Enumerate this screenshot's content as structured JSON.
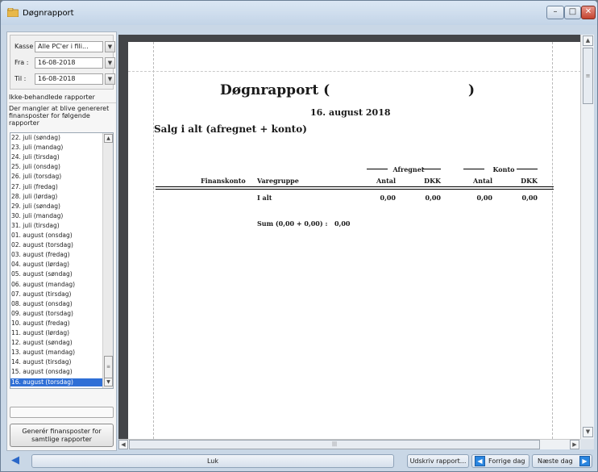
{
  "window": {
    "title": "Døgnrapport"
  },
  "filters": {
    "kasse_label": "Kasse :",
    "kasse_value": "Alle PC'er i fili...",
    "fra_label": "Fra :",
    "fra_value": "16-08-2018",
    "til_label": "Til :",
    "til_value": "16-08-2018"
  },
  "sidebar": {
    "section_title": "Ikke-behandlede rapporter",
    "description": "Der mangler at blive genereret finansposter for følgende rapporter",
    "dates": [
      "22. juli (søndag)",
      "23. juli (mandag)",
      "24. juli (tirsdag)",
      "25. juli (onsdag)",
      "26. juli (torsdag)",
      "27. juli (fredag)",
      "28. juli (lørdag)",
      "29. juli (søndag)",
      "30. juli (mandag)",
      "31. juli (tirsdag)",
      "01. august (onsdag)",
      "02. august (torsdag)",
      "03. august (fredag)",
      "04. august (lørdag)",
      "05. august (søndag)",
      "06. august (mandag)",
      "07. august (tirsdag)",
      "08. august (onsdag)",
      "09. august (torsdag)",
      "10. august (fredag)",
      "11. august (lørdag)",
      "12. august (søndag)",
      "13. august (mandag)",
      "14. august (tirsdag)",
      "15. august (onsdag)",
      "16. august (torsdag)"
    ],
    "selected_date": "16. august (torsdag)",
    "generate_button": "Generér finansposter for samtlige rapporter"
  },
  "report": {
    "title": "Døgnrapport (",
    "title_tail": ")",
    "date": "16. august 2018",
    "subtitle": "Salg i alt (afregnet + konto)",
    "group_afregnet": "Afregnet",
    "group_konto": "Konto",
    "col_finanskonto": "Finanskonto",
    "col_varegruppe": "Varegruppe",
    "col_antal_1": "Antal",
    "col_dkk_1": "DKK",
    "col_antal_2": "Antal",
    "col_dkk_2": "DKK",
    "row_label": "I alt",
    "row_antal_1": "0,00",
    "row_dkk_1": "0,00",
    "row_antal_2": "0,00",
    "row_dkk_2": "0,00",
    "sum_label": "Sum (0,00 + 0,00) :",
    "sum_value": "0,00"
  },
  "bottom": {
    "luk": "Luk",
    "udskriv": "Udskriv rapport...",
    "forrige": "Forrige dag",
    "naeste": "Næste dag"
  },
  "colors": {
    "accent": "#2f6fd6",
    "preview_bg": "#434548",
    "chrome": "#c9d7e6"
  }
}
